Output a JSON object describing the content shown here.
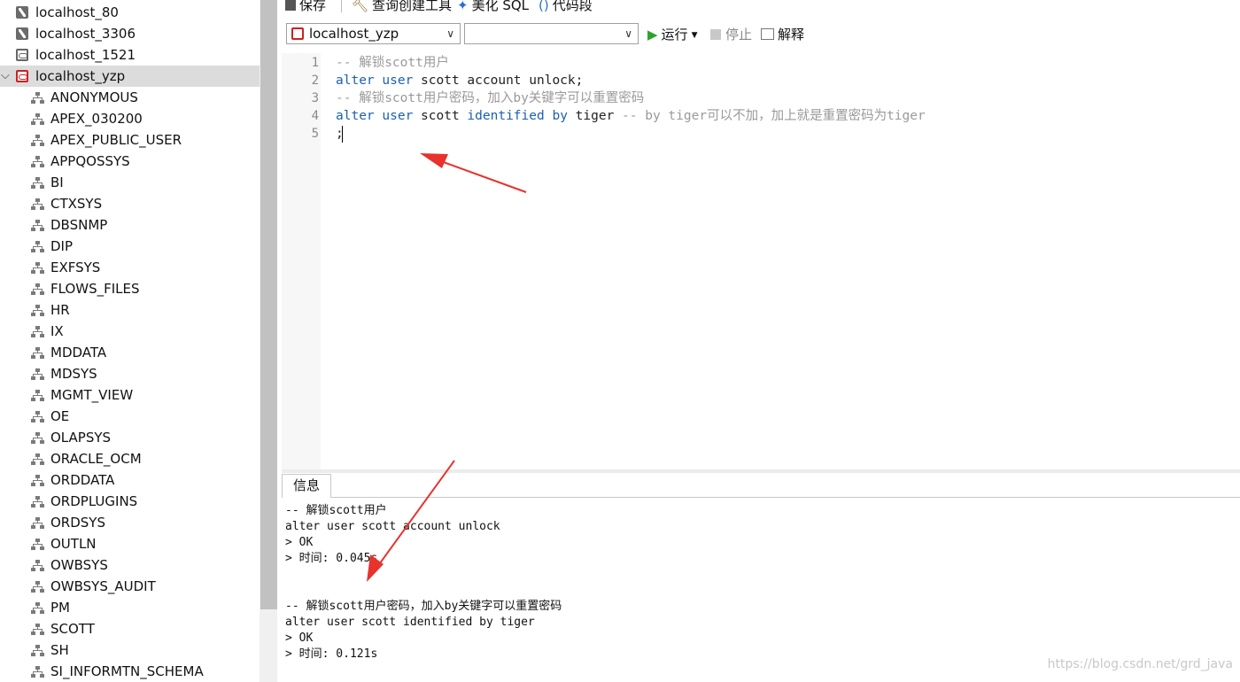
{
  "sidebar": {
    "connections": [
      {
        "label": "localhost_80",
        "icon": "mysql-icon"
      },
      {
        "label": "localhost_3306",
        "icon": "mysql-icon"
      },
      {
        "label": "localhost_1521",
        "icon": "oracle-icon"
      },
      {
        "label": "localhost_yzp",
        "icon": "oracle-icon",
        "expanded": true,
        "selected": true
      }
    ],
    "schemas": [
      "ANONYMOUS",
      "APEX_030200",
      "APEX_PUBLIC_USER",
      "APPQOSSYS",
      "BI",
      "CTXSYS",
      "DBSNMP",
      "DIP",
      "EXFSYS",
      "FLOWS_FILES",
      "HR",
      "IX",
      "MDDATA",
      "MDSYS",
      "MGMT_VIEW",
      "OE",
      "OLAPSYS",
      "ORACLE_OCM",
      "ORDDATA",
      "ORDPLUGINS",
      "ORDSYS",
      "OUTLN",
      "OWBSYS",
      "OWBSYS_AUDIT",
      "PM",
      "SCOTT",
      "SH",
      "SI_INFORMTN_SCHEMA"
    ]
  },
  "toolbar": {
    "save_label": "保存",
    "query_builder_label": "查询创建工具",
    "beautify_label": "美化 SQL",
    "snippet_label": "代码段",
    "connection_value": "localhost_yzp",
    "schema_value": "",
    "run_label": "运行",
    "stop_label": "停止",
    "explain_label": "解释"
  },
  "editor": {
    "line_numbers": [
      "1",
      "2",
      "3",
      "4",
      "5"
    ],
    "lines": [
      {
        "comment": "-- 解锁scott用户"
      },
      {
        "kw1": "alter",
        "kw2": "user",
        "rest": " scott account unlock;"
      },
      {
        "comment": "-- 解锁scott用户密码，加入by关键字可以重置密码"
      },
      {
        "kw1": "alter",
        "kw2": "user",
        "mid": " scott ",
        "kw3": "identified",
        "kw4": "by",
        "mid2": " tiger ",
        "tail_comment": "-- by tiger可以不加，加上就是重置密码为tiger"
      },
      {
        "text": ";"
      }
    ]
  },
  "info_panel": {
    "tab_label": "信息",
    "output": [
      "-- 解锁scott用户",
      "alter user scott account unlock",
      "> OK",
      "> 时间: 0.045s",
      "",
      "",
      "-- 解锁scott用户密码，加入by关键字可以重置密码",
      "alter user scott identified by tiger",
      "> OK",
      "> 时间: 0.121s"
    ]
  },
  "watermark": "https://blog.csdn.net/grd_java",
  "colors": {
    "keyword": "#1b5fb5",
    "comment": "#9a9a9a",
    "arrow": "#e8322c",
    "run": "#2aa52a"
  }
}
